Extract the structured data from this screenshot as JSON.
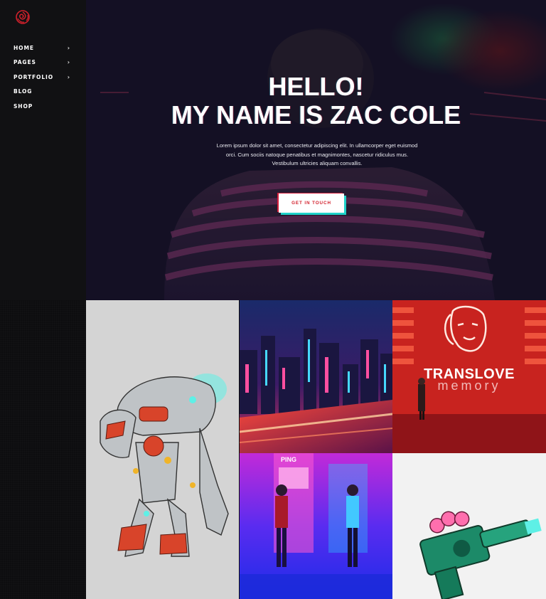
{
  "sidebar": {
    "logo": "rose-logo-icon",
    "nav": [
      {
        "label": "HOME",
        "has_submenu": true
      },
      {
        "label": "PAGES",
        "has_submenu": true
      },
      {
        "label": "PORTFOLIO",
        "has_submenu": true
      },
      {
        "label": "BLOG",
        "has_submenu": false
      },
      {
        "label": "SHOP",
        "has_submenu": false
      }
    ],
    "chevron": "›"
  },
  "hero": {
    "title_line1": "HELLO!",
    "title_line2": "MY NAME IS ZAC COLE",
    "text": "Lorem ipsum dolor sit amet, consectetur adipiscing elit. In ullamcorper eget euismod orci. Cum sociis natoque penatibus et magnimontes, nascetur ridiculus mus. Vestibulum ultricies aliquam convallis.",
    "cta_label": "GET IN TOUCH"
  },
  "portfolio": {
    "translove": {
      "word1": "TRANS",
      "word2": "LOVE",
      "sub": "memory"
    },
    "arcade_sign": "PING"
  },
  "colors": {
    "accent_red": "#d21f2b",
    "accent_cyan": "#1fd2c9",
    "sidebar_bg": "#0d0d0f"
  }
}
